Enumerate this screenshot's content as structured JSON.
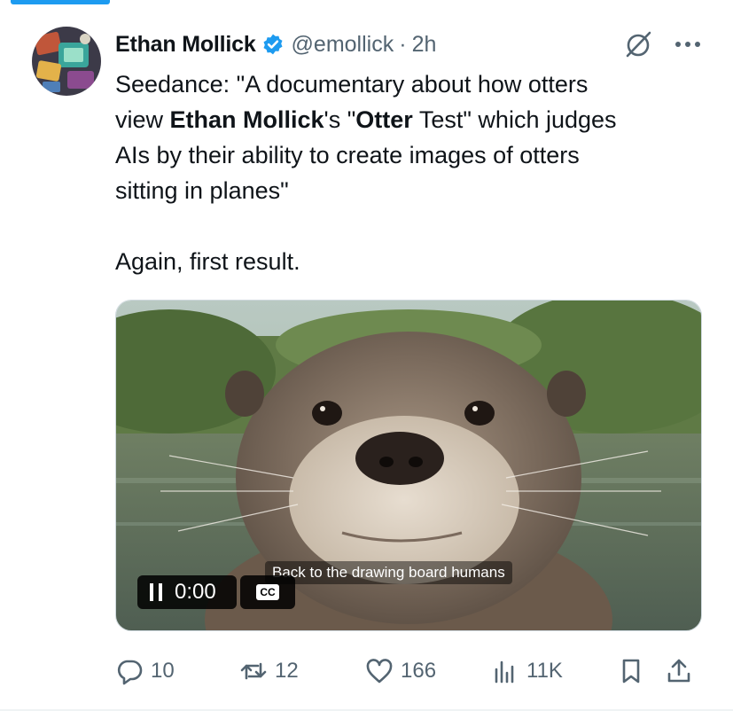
{
  "author": {
    "name": "Ethan Mollick",
    "handle": "@emollick",
    "separator": "·",
    "time": "2h"
  },
  "tweet": {
    "line1": "Seedance: \"A documentary about how otters",
    "line2_prefix": "view ",
    "line2_bold1": "Ethan Mollick",
    "line2_mid": "'s \"",
    "line2_bold2": "Otter",
    "line2_suffix": " Test\" which  judges",
    "line3": "AIs by their ability to create images of otters",
    "line4": "sitting in planes\"",
    "line5": "Again, first result."
  },
  "video": {
    "caption": "Back to the drawing board humans",
    "time": "0:00",
    "cc_label": "CC"
  },
  "actions": {
    "replies": "10",
    "reposts": "12",
    "likes": "166",
    "views": "11K"
  },
  "colors": {
    "accent": "#1d9bf0",
    "muted": "#536471",
    "text": "#0f1419"
  },
  "icons": [
    "verified-badge-icon",
    "grok-icon",
    "more-icon",
    "pause-icon",
    "reply-icon",
    "repost-icon",
    "like-icon",
    "views-icon",
    "bookmark-icon",
    "share-icon"
  ]
}
